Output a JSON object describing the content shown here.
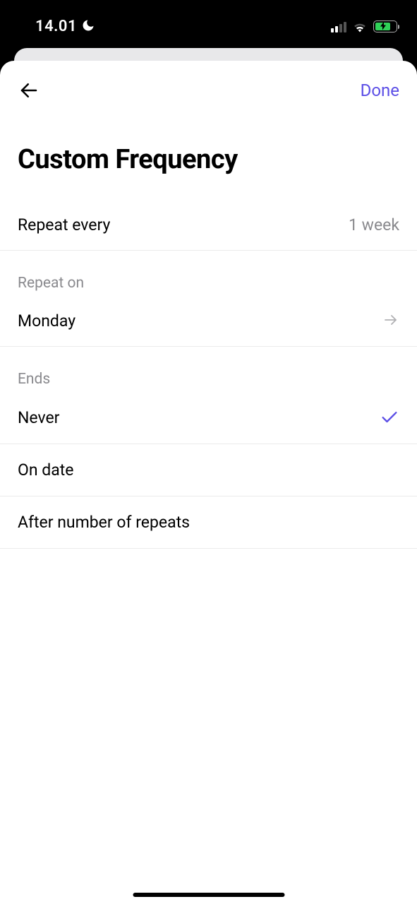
{
  "status_bar": {
    "time": "14.01"
  },
  "nav": {
    "done_label": "Done"
  },
  "page": {
    "title": "Custom Frequency"
  },
  "repeat_every": {
    "label": "Repeat every",
    "value": "1 week"
  },
  "repeat_on": {
    "header": "Repeat on",
    "value": "Monday"
  },
  "ends": {
    "header": "Ends",
    "options": [
      {
        "label": "Never",
        "selected": true
      },
      {
        "label": "On date",
        "selected": false
      },
      {
        "label": "After number of repeats",
        "selected": false
      }
    ]
  }
}
